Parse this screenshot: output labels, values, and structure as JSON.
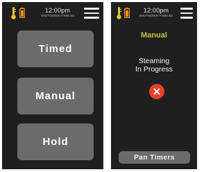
{
  "left_screen": {
    "status": {
      "time": "12:00pm",
      "subtitle": "SHUTDOWN H:MM:SS"
    },
    "buttons": [
      {
        "label": "Timed"
      },
      {
        "label": "Manual"
      },
      {
        "label": "Hold"
      }
    ]
  },
  "right_screen": {
    "status": {
      "time": "12:00pm",
      "subtitle": "SHUTDOWN H:MM:SS"
    },
    "mode_title": "Manual",
    "status_line1": "Steaming",
    "status_line2": "In Progress",
    "pan_timers_label": "Pan Timers"
  },
  "colors": {
    "background": "#1f1f1f",
    "button": "#6b6b6b",
    "accent_yellow": "#c9c23a",
    "thermometer": "#e8c62a",
    "battery": "#f08a1c",
    "cancel": "#e8412a"
  },
  "icons": [
    "thermometer-icon",
    "battery-icon",
    "hamburger-menu-icon",
    "close-icon"
  ]
}
